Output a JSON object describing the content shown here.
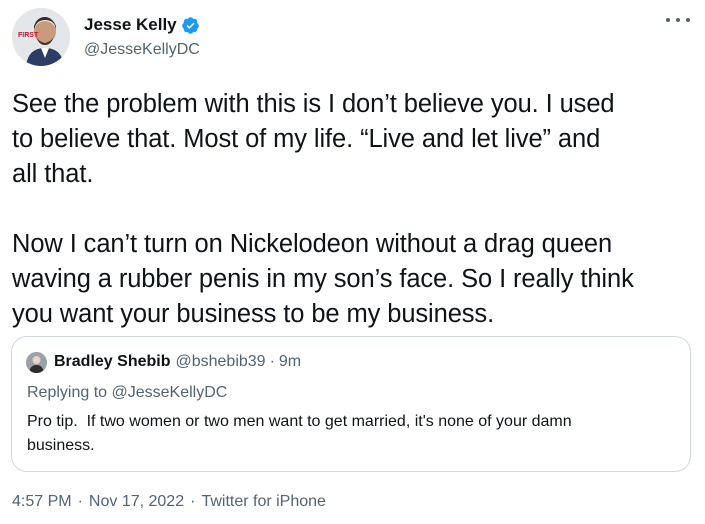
{
  "author": {
    "display_name": "Jesse Kelly",
    "handle": "@JesseKellyDC",
    "avatar_badge": "FIRST",
    "verified_icon": "verified-badge-icon",
    "verified_color": "#1d9bf0"
  },
  "more_icon": "more-options-icon",
  "tweet": {
    "text": "See the problem with this is I don’t believe you. I used\nto believe that. Most of my life. “Live and let live” and\nall that.\n\nNow I can’t turn on Nickelodeon without a drag queen\nwaving a rubber penis in my son’s face. So I really think\nyou want your business to be my business."
  },
  "quoted_tweet": {
    "display_name": "Bradley Shebib",
    "handle": "@bshebib39",
    "separator": "·",
    "time": "9m",
    "replying_to": "Replying to @JesseKellyDC",
    "text": "Pro tip.  If two women or two men want to get married, it's none of your damn\nbusiness."
  },
  "footer": {
    "time": "4:57 PM",
    "date": "Nov 17, 2022",
    "source": "Twitter for iPhone",
    "separator": "·"
  },
  "colors": {
    "text_primary": "#0f1419",
    "text_secondary": "#536471",
    "border": "#cfd9de"
  }
}
